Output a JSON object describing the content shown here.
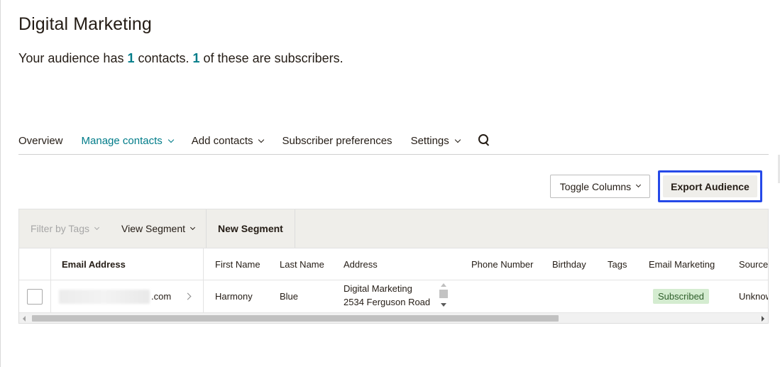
{
  "page": {
    "title": "Digital Marketing",
    "summary_prefix": "Your audience has ",
    "contacts_count": "1",
    "summary_middle": " contacts. ",
    "subscribers_count": "1",
    "summary_suffix": " of these are subscribers."
  },
  "nav": {
    "overview": "Overview",
    "manage_contacts": "Manage contacts",
    "add_contacts": "Add contacts",
    "subscriber_preferences": "Subscriber preferences",
    "settings": "Settings",
    "search_icon": "search-icon",
    "active_color": "#007c89"
  },
  "actions": {
    "toggle_columns": "Toggle Columns",
    "export_audience": "Export Audience",
    "highlight_color": "#2549e8"
  },
  "toolbar": {
    "filter_by_tags": "Filter by Tags",
    "view_segment": "View Segment",
    "new_segment": "New Segment"
  },
  "table": {
    "columns": [
      "Email Address",
      "First Name",
      "Last Name",
      "Address",
      "Phone Number",
      "Birthday",
      "Tags",
      "Email Marketing",
      "Source"
    ],
    "rows": [
      {
        "email_suffix": ".com",
        "first_name": "Harmony",
        "last_name": "Blue",
        "address": "Digital Marketing 2534 Ferguson Road",
        "phone_number": "",
        "birthday": "",
        "tags": "",
        "email_marketing": "Subscribed",
        "source": "Unknown"
      }
    ]
  }
}
